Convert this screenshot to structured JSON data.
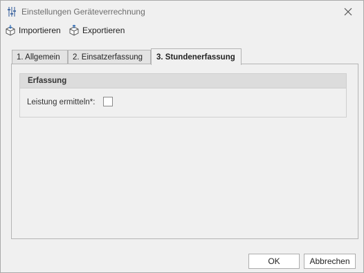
{
  "window": {
    "title": "Einstellungen Geräteverrechnung",
    "title_icon": "sliders-icon",
    "close_icon": "close-icon"
  },
  "toolbar": {
    "import_label": "Importieren",
    "import_icon": "import-box-icon",
    "export_label": "Exportieren",
    "export_icon": "export-box-icon"
  },
  "tabs": [
    {
      "label": "1. Allgemein",
      "active": false
    },
    {
      "label": "2. Einsatzerfassung",
      "active": false
    },
    {
      "label": "3. Stundenerfassung",
      "active": true
    }
  ],
  "panel": {
    "group_title": "Erfassung",
    "field_label": "Leistung ermitteln*:",
    "checkbox_checked": false
  },
  "buttons": {
    "ok_label": "OK",
    "cancel_label": "Abbrechen"
  }
}
